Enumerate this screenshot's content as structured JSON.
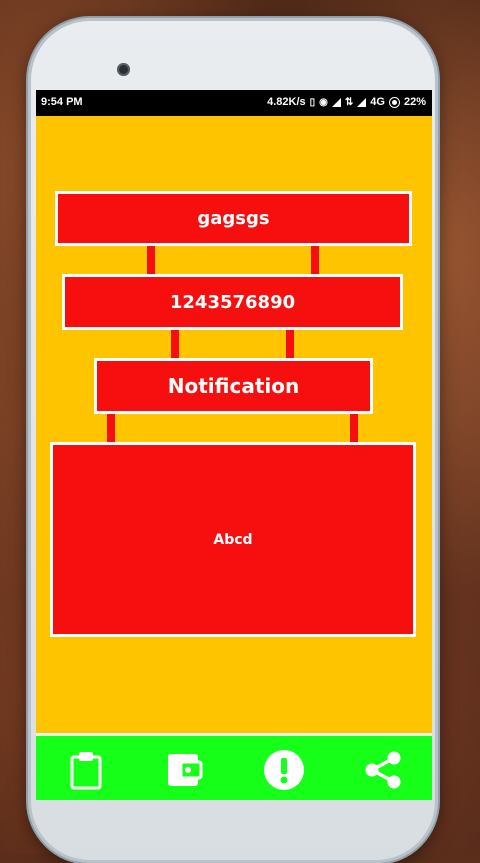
{
  "status_bar": {
    "time": "9:54 PM",
    "speed": "4.82K/s",
    "network": "4G",
    "battery": "22%"
  },
  "boxes": {
    "title": "gagsgs",
    "number": "1243576890",
    "notification": "Notification",
    "content": "Abcd"
  },
  "nav_icons": [
    "clipboard-icon",
    "wallet-icon",
    "alert-icon",
    "share-icon"
  ],
  "colors": {
    "background": "#ffc400",
    "box": "#f70e0e",
    "navbar": "#15ff19"
  }
}
